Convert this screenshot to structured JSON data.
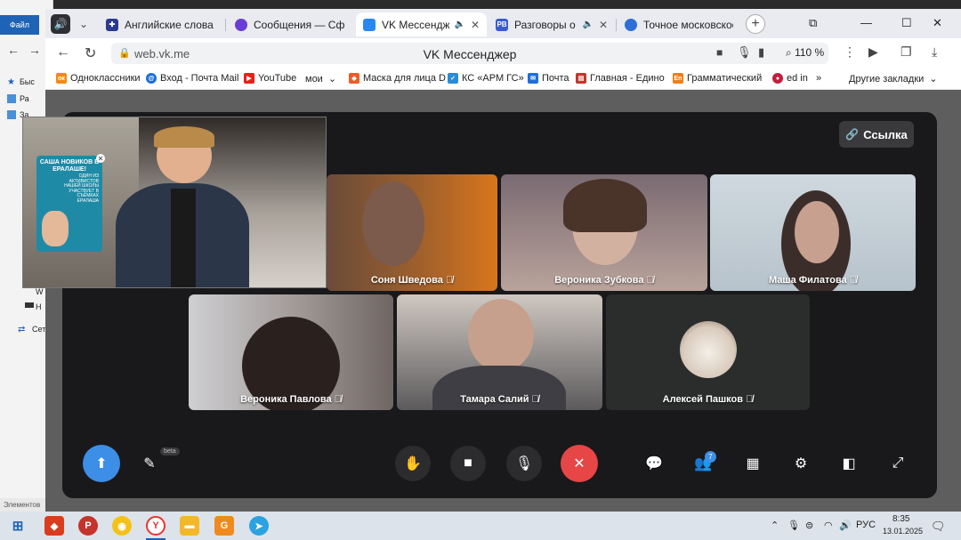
{
  "explorer": {
    "file_label": "Файл",
    "rows": [
      "Быс",
      "Ра",
      "За",
      "W",
      "Н",
      "Сет"
    ],
    "status": "Элементов"
  },
  "tabs": [
    {
      "label": "Английские слова по т",
      "sound": false,
      "active": false
    },
    {
      "label": "Сообщения — Сферум",
      "sound": false,
      "active": false
    },
    {
      "label": "VK Мессенджер",
      "sound": true,
      "active": true
    },
    {
      "label": "Разговоры о важ",
      "sound": true,
      "active": false
    },
    {
      "label": "Точное московское вр",
      "sound": false,
      "active": false
    }
  ],
  "toolbar": {
    "host": "web.vk.me",
    "page_title": "VK Мессенджер",
    "zoom": "110 %"
  },
  "bookmarks": [
    "Одноклассники",
    "Вход - Почта Mail",
    "YouTube",
    "мои",
    "Маска для лица D",
    "КС «АРМ ГС»",
    "Почта",
    "Главная - Едино",
    "Грамматический",
    "ed in",
    "Другие закладки"
  ],
  "call": {
    "link_label": "Ссылка",
    "participants": [
      {
        "name": "Соня Шведова",
        "muted": true
      },
      {
        "name": "Вероника Зубкова",
        "muted": true
      },
      {
        "name": "Маша Филатова",
        "muted": true
      },
      {
        "name": "Вероника Павлова",
        "muted": true
      },
      {
        "name": "Тамара Салий",
        "muted": true
      },
      {
        "name": "Алексей Пашков",
        "muted": true
      }
    ],
    "beta_badge": "beta",
    "participants_count": "7"
  },
  "pip": {
    "poster_title": "САША НОВИКОВ В ЕРАЛАШЕ!",
    "poster_sub": "ОДИН ИЗ АКТИВИСТОВ НАШЕЙ ШКОЛЫ УЧАСТВУЕТ В СЪЁМКАХ ЕРАЛАША"
  },
  "taskbar": {
    "lang": "РУС",
    "time": "8:35",
    "date": "13.01.2025"
  }
}
